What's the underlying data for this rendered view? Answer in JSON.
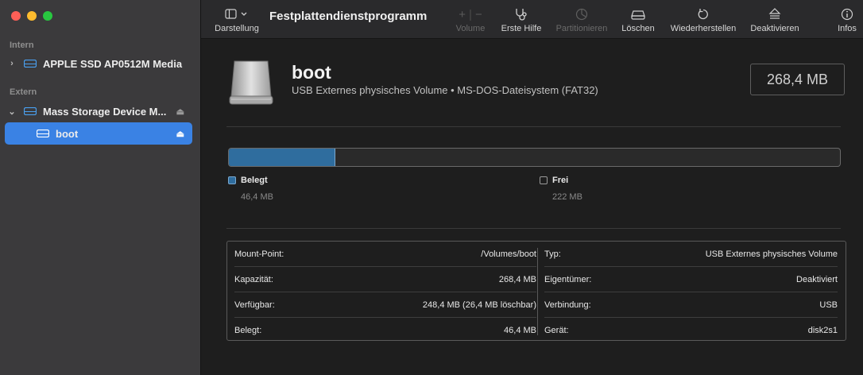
{
  "window": {
    "traffic_lights": {
      "close": "#ff5f57",
      "minimize": "#febc2e",
      "zoom": "#28c840"
    }
  },
  "sidebar": {
    "sections": [
      {
        "title": "Intern"
      },
      {
        "title": "Extern"
      }
    ],
    "items": [
      {
        "label": "APPLE SSD AP0512M Media",
        "icon": "internal-disk-icon",
        "expandable": true
      },
      {
        "label": "Mass Storage Device M...",
        "icon": "external-disk-icon",
        "expandable": true,
        "eject": true
      },
      {
        "label": "boot",
        "icon": "volume-icon",
        "eject": true,
        "selected": true
      }
    ]
  },
  "toolbar": {
    "title": "Festplattendienstprogramm",
    "view_label": "Darstellung",
    "volume_label": "Volume",
    "first_aid_label": "Erste Hilfe",
    "partition_label": "Partitionieren",
    "erase_label": "Löschen",
    "restore_label": "Wiederherstellen",
    "unmount_label": "Deaktivieren",
    "info_label": "Infos"
  },
  "volume": {
    "name": "boot",
    "description": "USB Externes physisches Volume • MS-DOS-Dateisystem (FAT32)",
    "size": "268,4 MB"
  },
  "usage": {
    "used_fraction": 0.173,
    "used_label": "Belegt",
    "used_value": "46,4 MB",
    "used_color": "#2f6d9e",
    "free_label": "Frei",
    "free_value": "222 MB"
  },
  "details": {
    "left": [
      {
        "key": "Mount-Point:",
        "value": "/Volumes/boot"
      },
      {
        "key": "Kapazität:",
        "value": "268,4 MB"
      },
      {
        "key": "Verfügbar:",
        "value": "248,4 MB (26,4 MB löschbar)"
      },
      {
        "key": "Belegt:",
        "value": "46,4 MB"
      }
    ],
    "right": [
      {
        "key": "Typ:",
        "value": "USB Externes physisches Volume"
      },
      {
        "key": "Eigentümer:",
        "value": "Deaktiviert"
      },
      {
        "key": "Verbindung:",
        "value": "USB"
      },
      {
        "key": "Gerät:",
        "value": "disk2s1"
      }
    ]
  }
}
